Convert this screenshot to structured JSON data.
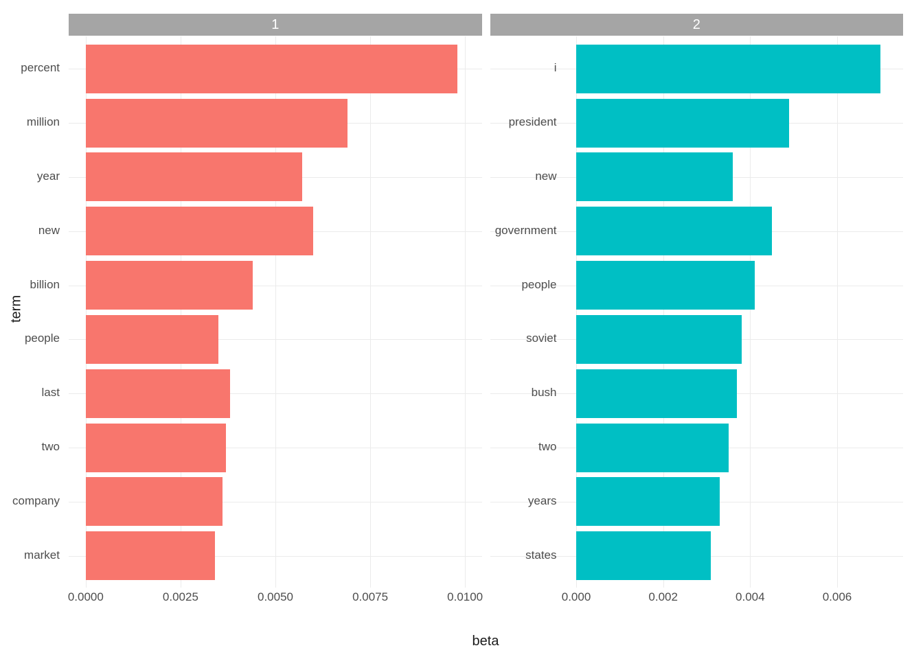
{
  "ylabel": "term",
  "xlabel": "beta",
  "facets": [
    {
      "strip": "1",
      "xlim": [
        0.0,
        0.01
      ],
      "xticks": [
        "0.0000",
        "0.0025",
        "0.0050",
        "0.0075",
        "0.0100"
      ],
      "color": "#F8766D"
    },
    {
      "strip": "2",
      "xlim": [
        0.0,
        0.0072
      ],
      "xticks": [
        "0.000",
        "0.002",
        "0.004",
        "0.006"
      ],
      "color": "#00BFC4"
    }
  ],
  "chart_data": [
    {
      "type": "bar",
      "orientation": "horizontal",
      "categories": [
        "percent",
        "million",
        "year",
        "new",
        "billion",
        "people",
        "last",
        "two",
        "company",
        "market"
      ],
      "values": [
        0.0098,
        0.0069,
        0.0057,
        0.006,
        0.0044,
        0.0035,
        0.0038,
        0.0037,
        0.0036,
        0.0034
      ],
      "xlabel": "beta",
      "ylabel": "term",
      "title": "1",
      "xlim": [
        0.0,
        0.01
      ]
    },
    {
      "type": "bar",
      "orientation": "horizontal",
      "categories": [
        "i",
        "president",
        "new",
        "government",
        "people",
        "soviet",
        "bush",
        "two",
        "years",
        "states"
      ],
      "values": [
        0.007,
        0.0049,
        0.0036,
        0.0045,
        0.0041,
        0.0038,
        0.0037,
        0.0035,
        0.0033,
        0.0031
      ],
      "xlabel": "beta",
      "ylabel": "term",
      "title": "2",
      "xlim": [
        0.0,
        0.0072
      ]
    }
  ]
}
